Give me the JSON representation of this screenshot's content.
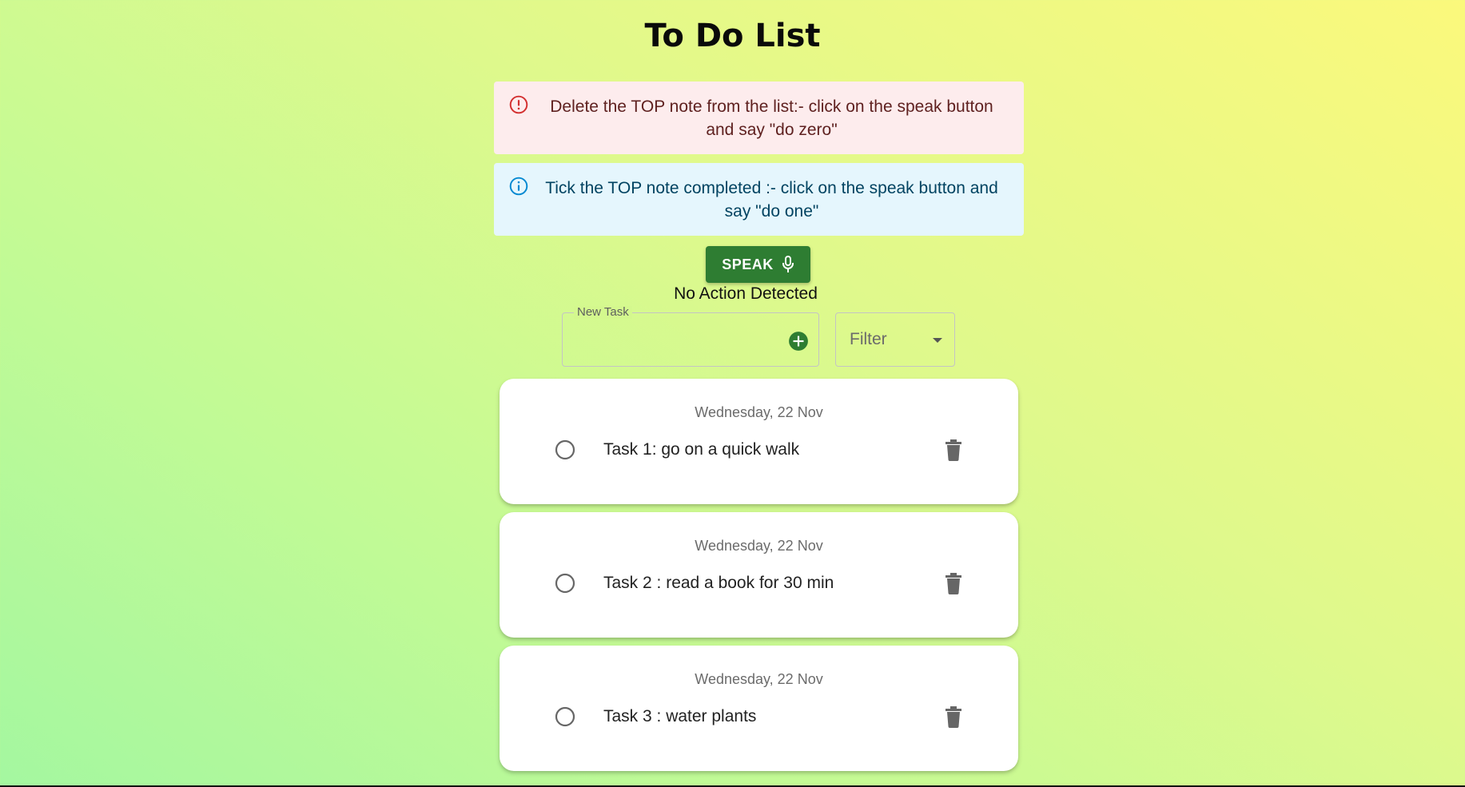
{
  "page": {
    "title": "To Do List"
  },
  "alerts": {
    "error": {
      "icon": "error-outline-icon",
      "text": "Delete the TOP note from the list:- click on the speak button and say \"do zero\"",
      "color": "#d32f2f"
    },
    "info": {
      "icon": "info-outline-icon",
      "text": "Tick the TOP note completed :- click on the speak button and say \"do one\"",
      "color": "#0288d1"
    }
  },
  "speak": {
    "label": "SPEAK",
    "icon": "mic-icon",
    "color": "#2e7d32"
  },
  "status": {
    "text": "No Action Detected"
  },
  "new_task": {
    "label": "New Task",
    "value": "",
    "add_icon": "add-circle-icon"
  },
  "filter": {
    "label": "Filter",
    "icon": "arrow-drop-down-icon"
  },
  "tasks": [
    {
      "date": "Wednesday, 22 Nov",
      "text": "Task 1: go on a quick walk",
      "completed": false
    },
    {
      "date": "Wednesday, 22 Nov",
      "text": "Task 2 : read a book for 30 min",
      "completed": false
    },
    {
      "date": "Wednesday, 22 Nov",
      "text": "Task 3 : water plants",
      "completed": false
    }
  ]
}
